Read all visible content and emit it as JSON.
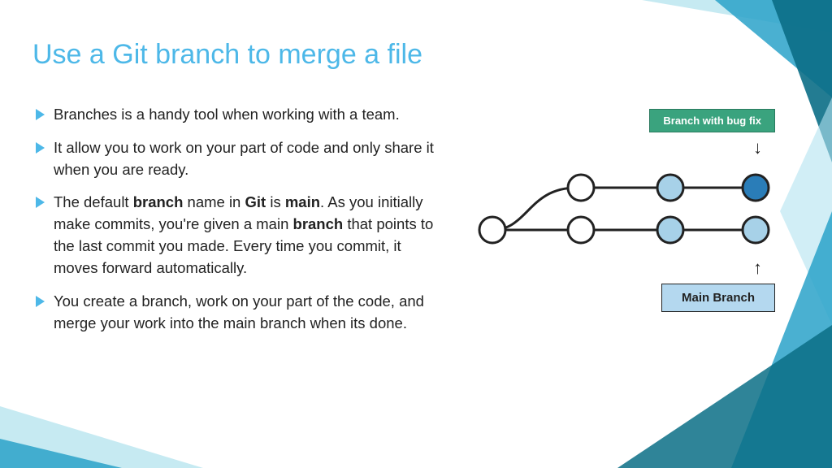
{
  "title": "Use a Git branch to merge a file",
  "bullets": [
    {
      "html": "Branches is a handy tool when working with a team."
    },
    {
      "html": "It allow you to work on your part of code and only share it when you are ready."
    },
    {
      "html": "The default <b>branch</b> name in <b>Git</b> is <b>main</b>. As you initially make commits, you're given a main <b>branch</b> that points to the last commit you made. Every time you commit, it moves forward automatically."
    },
    {
      "html": "You create a branch, work on your part of the code, and merge your work into the main branch when its done."
    }
  ],
  "diagram": {
    "branch_label": "Branch with bug fix",
    "main_label": "Main Branch"
  },
  "colors": {
    "accent": "#4db8e8",
    "triangle_light": "#b2e3f0",
    "triangle_mid": "#2aa2c9",
    "triangle_dark": "#0b6e86"
  }
}
